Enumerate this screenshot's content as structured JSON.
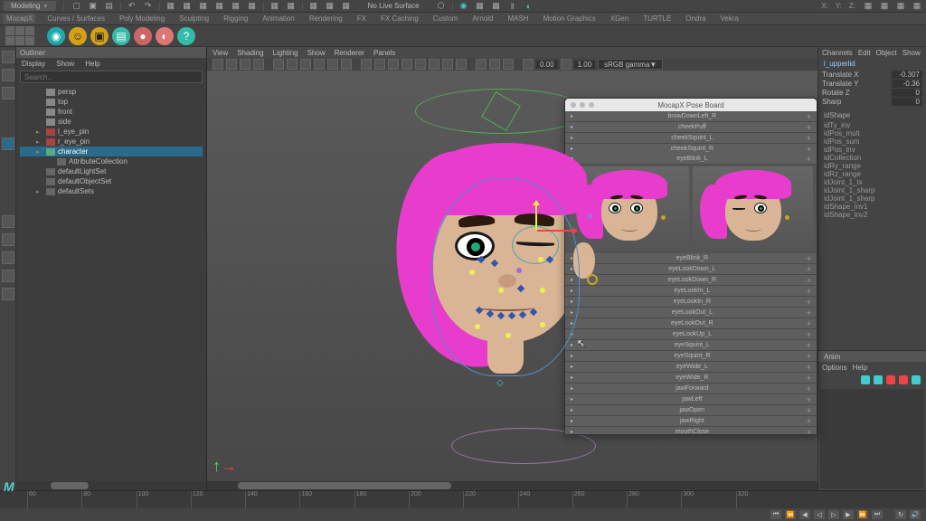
{
  "topbar": {
    "workspace": "Modeling",
    "status": "No Live Surface",
    "coords": {
      "x": "X:",
      "y": "Y:",
      "z": "Z:"
    }
  },
  "shelves": [
    "MocapX",
    "Curves / Surfaces",
    "Poly Modeling",
    "Sculpting",
    "Rigging",
    "Animation",
    "Rendering",
    "FX",
    "FX Caching",
    "Custom",
    "Arnold",
    "MASH",
    "Motion Graphics",
    "XGen",
    "TURTLE",
    "Ondra",
    "Vekra"
  ],
  "outliner": {
    "title": "Outliner",
    "menu": [
      "Display",
      "Show",
      "Help"
    ],
    "search_placeholder": "Search...",
    "tree": [
      {
        "label": "persp",
        "icon": "cam",
        "indent": 1
      },
      {
        "label": "top",
        "icon": "cam",
        "indent": 1
      },
      {
        "label": "front",
        "icon": "cam",
        "indent": 1
      },
      {
        "label": "side",
        "icon": "cam",
        "indent": 1
      },
      {
        "label": "l_eye_pin",
        "icon": "pin",
        "indent": 1,
        "toggle": "▸"
      },
      {
        "label": "r_eye_pin",
        "icon": "pin",
        "indent": 1,
        "toggle": "▸"
      },
      {
        "label": "character",
        "icon": "cube",
        "indent": 1,
        "toggle": "▸",
        "selected": true
      },
      {
        "label": "AttributeCollection",
        "icon": "default",
        "indent": 2
      },
      {
        "label": "defaultLightSet",
        "icon": "default",
        "indent": 1
      },
      {
        "label": "defaultObjectSet",
        "icon": "default",
        "indent": 1
      },
      {
        "label": "defaultSets",
        "icon": "default",
        "indent": 1,
        "toggle": "▸"
      }
    ]
  },
  "viewport": {
    "menu": [
      "View",
      "Shading",
      "Lighting",
      "Show",
      "Renderer",
      "Panels"
    ],
    "frame": "0.00",
    "range": "1.00",
    "color_mgmt": "sRGB gamma"
  },
  "pose_board": {
    "title": "MocapX Pose Board",
    "top_rows": [
      "browDownLeft_R",
      "cheekPuff",
      "cheekSquint_L",
      "cheekSquint_R",
      "eyeBlink_L"
    ],
    "scroll_rows": [
      "eyeBlink_R",
      "eyeLookDown_L",
      "eyeLookDown_R",
      "eyeLookIn_L",
      "eyeLookIn_R",
      "eyeLookOut_L",
      "eyeLookOut_R",
      "eyeLookUp_L",
      "eyeSquint_L",
      "eyeSquint_R",
      "eyeWide_L",
      "eyeWide_R",
      "jawForward",
      "jawLeft",
      "jawOpen",
      "jawRight",
      "mouthClose"
    ]
  },
  "channel_box": {
    "tabs": [
      "Channels",
      "Edit",
      "Object",
      "Show"
    ],
    "node": "l_upperlid",
    "channels": [
      {
        "name": "Translate X",
        "value": "-0.307"
      },
      {
        "name": "Translate Y",
        "value": "-0.36"
      },
      {
        "name": "Rotate Z",
        "value": "0"
      },
      {
        "name": "Sharp",
        "value": "0"
      }
    ],
    "shapes_label": "idShape",
    "shapes": [
      "idTy_inv",
      "idPos_mult",
      "idPos_sum",
      "idPos_inv",
      "idCollection",
      "idRy_range",
      "idRz_range",
      "idJoint_1_tx",
      "idJoint_1_sharp",
      "idJoint_1_sharp",
      "idShape_inv1",
      "idShape_inv2"
    ],
    "anim": {
      "title": "Anim",
      "menu": [
        "Options",
        "Help"
      ]
    }
  },
  "timeline": {
    "ticks": [
      "60",
      "80",
      "100",
      "120",
      "140",
      "160",
      "180",
      "200",
      "220",
      "240",
      "260",
      "280",
      "300",
      "320"
    ]
  }
}
